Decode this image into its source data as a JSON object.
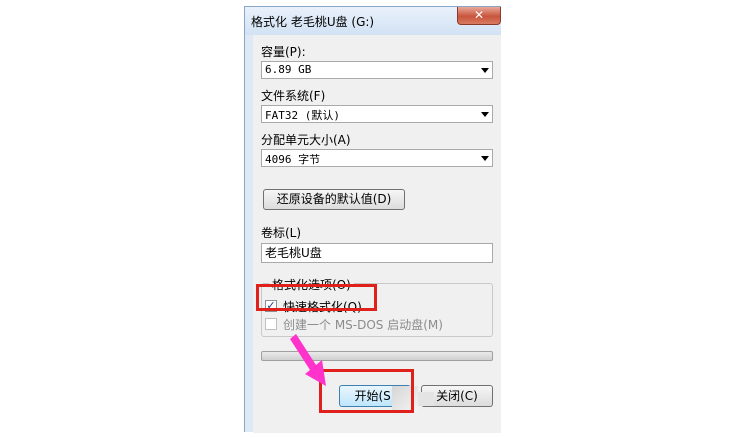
{
  "window": {
    "title": "格式化 老毛桃U盘 (G:)",
    "close_glyph": "✕"
  },
  "capacity": {
    "label": "容量(P):",
    "value": "6.89 GB"
  },
  "filesystem": {
    "label": "文件系统(F)",
    "value": "FAT32 (默认)"
  },
  "allocation": {
    "label": "分配单元大小(A)",
    "value": "4096 字节"
  },
  "restore_defaults_label": "还原设备的默认值(D)",
  "volume": {
    "label": "卷标(L)",
    "value": "老毛桃U盘"
  },
  "format_options": {
    "title": "格式化选项(O)",
    "quick_format": {
      "label": "快速格式化(Q)",
      "checked": true,
      "check_glyph": "✓"
    },
    "msdos_disk": {
      "label": "创建一个 MS-DOS 启动盘(M)",
      "checked": false,
      "enabled": false
    }
  },
  "progress": {
    "value": 0
  },
  "buttons": {
    "start": "开始(S)",
    "close": "关闭(C)"
  },
  "colors": {
    "highlight": "#e0201b",
    "arrow": "#ff33cc"
  }
}
